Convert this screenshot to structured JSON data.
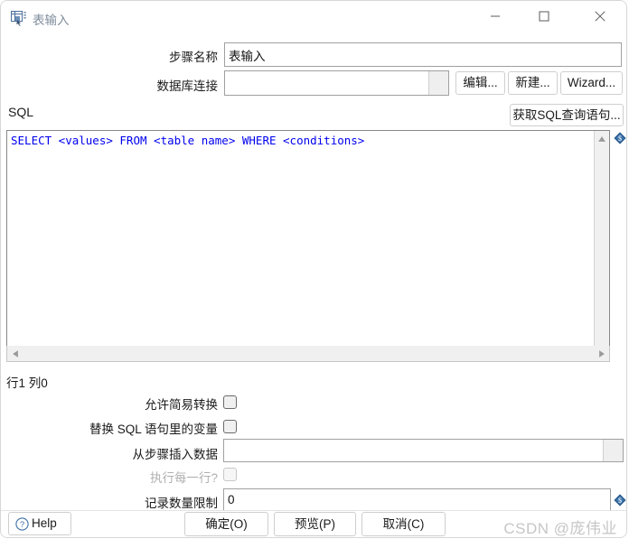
{
  "window": {
    "title": "表输入",
    "icon": "table-input-icon",
    "controls": {
      "minimize": "minimize-icon",
      "maximize": "maximize-icon",
      "close": "close-icon"
    }
  },
  "form": {
    "step_name": {
      "label": "步骤名称",
      "value": "表输入",
      "placeholder": ""
    },
    "db_connection": {
      "label": "数据库连接",
      "value": "",
      "placeholder": "",
      "buttons": {
        "edit": "编辑...",
        "new": "新建...",
        "wizard": "Wizard..."
      }
    }
  },
  "sql": {
    "label": "SQL",
    "get_query_button": "获取SQL查询语句...",
    "text": "SELECT <values> FROM <table name> WHERE <conditions>",
    "status": "行1 列0",
    "variable_icon": "variable-insert-icon"
  },
  "options": {
    "allow_lazy_conversion": {
      "label": "允许简易转换",
      "checked": false,
      "enabled": true
    },
    "replace_variables": {
      "label": "替换 SQL 语句里的变量",
      "checked": false,
      "enabled": true
    },
    "insert_data_from_step": {
      "label": "从步骤插入数据",
      "value": "",
      "placeholder": ""
    },
    "execute_for_each_row": {
      "label": "执行每一行?",
      "checked": false,
      "enabled": false
    },
    "limit_size": {
      "label": "记录数量限制",
      "value": "0",
      "placeholder": ""
    }
  },
  "footer": {
    "help": "Help",
    "ok": "确定(O)",
    "preview": "预览(P)",
    "cancel": "取消(C)",
    "watermark": "CSDN @庞伟业"
  },
  "colors": {
    "sql_keyword": "#0000ee",
    "title_text": "#7f8c9b",
    "accent": "#2b5a8c",
    "watermark": "#c6c6c6"
  }
}
